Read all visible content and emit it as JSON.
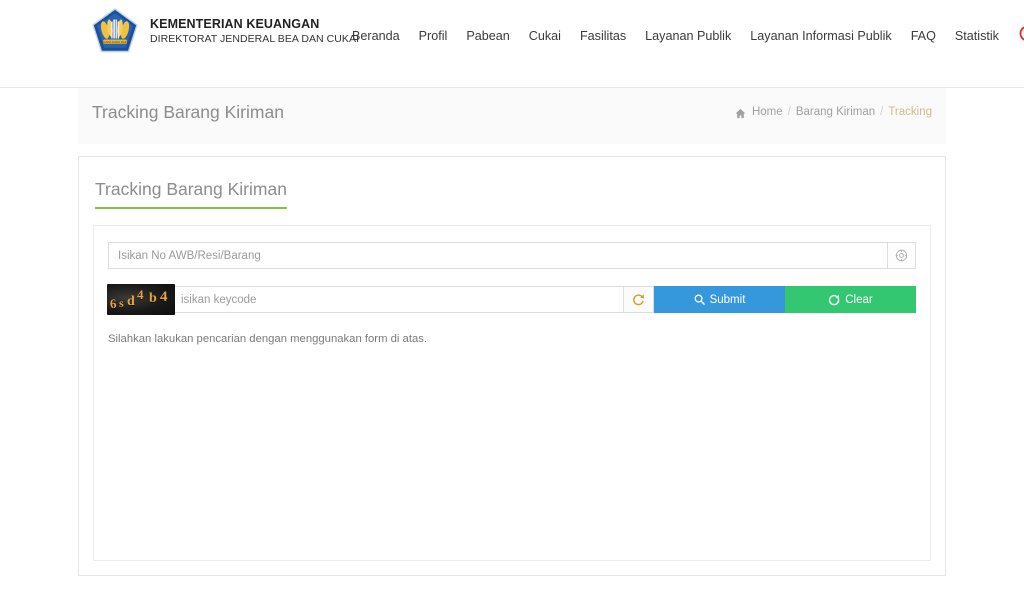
{
  "header": {
    "brand": {
      "logo_icon": "kemenkeu-pentagon-logo",
      "title": "KEMENTERIAN KEUANGAN",
      "subtitle": "DIREKTORAT JENDERAL BEA DAN CUKAI"
    },
    "nav_items": [
      {
        "label": "Beranda"
      },
      {
        "label": "Profil"
      },
      {
        "label": "Pabean"
      },
      {
        "label": "Cukai"
      },
      {
        "label": "Fasilitas"
      },
      {
        "label": "Layanan Publik"
      },
      {
        "label": "Layanan Informasi Publik"
      },
      {
        "label": "FAQ"
      },
      {
        "label": "Statistik"
      }
    ],
    "search_icon": "search-icon",
    "search_icon_color": "#e02b20"
  },
  "page": {
    "title": "Tracking Barang Kiriman",
    "breadcrumb": {
      "home_icon": "home-icon",
      "home_label": "Home",
      "separator": "/",
      "parent_label": "Barang Kiriman",
      "current_label": "Tracking",
      "current_color": "#cfbb8e"
    }
  },
  "card": {
    "title": "Tracking Barang Kiriman",
    "title_underline_color": "#82c341",
    "form": {
      "awb_input": {
        "value": "",
        "placeholder": "Isikan No AWB/Resi/Barang",
        "addon_icon": "compass-icon"
      },
      "keycode_input": {
        "value": "",
        "placeholder": "isikan keycode"
      },
      "captcha": {
        "characters": [
          "6",
          "s",
          "d",
          "4",
          "b",
          "4"
        ],
        "text": "6sd4b4",
        "text_color": "#e8a33d",
        "background_color": "#191919"
      },
      "refresh_button": {
        "icon": "refresh-icon",
        "icon_color": "#d99b2b"
      },
      "submit_button": {
        "label": "Submit",
        "icon": "search-icon",
        "color": "#3598dc"
      },
      "clear_button": {
        "label": "Clear",
        "icon": "recycle-icon",
        "color": "#32c770"
      }
    },
    "result_message": "Silahkan lakukan pencarian dengan menggunakan form di atas."
  }
}
